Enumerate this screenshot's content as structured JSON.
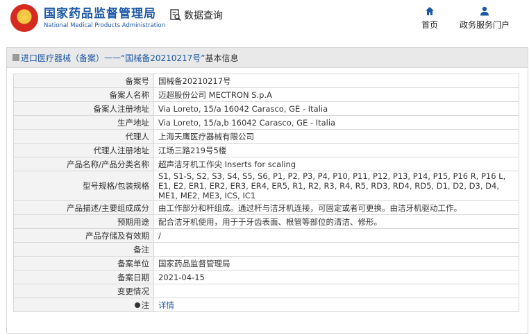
{
  "header": {
    "logo_cn": "国家药品监督管理局",
    "logo_en": "National Medical Products Administration",
    "search_label": "数据查询",
    "nav_home": "首页",
    "nav_portal": "政务服务门户"
  },
  "panel": {
    "title_prefix": "进口医疗器械（备案）",
    "title_sep": "——",
    "title_record": "“国械备20210217号”",
    "title_suffix": "基本信息"
  },
  "rows": [
    {
      "k": "备案号",
      "v": "国械备20210217号"
    },
    {
      "k": "备案人名称",
      "v": "迈超股份公司 MECTRON S.p.A"
    },
    {
      "k": "备案人注册地址",
      "v": "Via Loreto, 15/a 16042 Carasco, GE - Italia"
    },
    {
      "k": "生产地址",
      "v": "Via Loreto, 15/a,b 16042 Carasco, GE - Italia"
    },
    {
      "k": "代理人",
      "v": "上海天鹰医疗器械有限公司"
    },
    {
      "k": "代理人注册地址",
      "v": "江场三路219号5楼"
    },
    {
      "k": "产品名称/产品分类名称",
      "v": "超声洁牙机工作尖 Inserts for scaling"
    },
    {
      "k": "型号规格/包装规格",
      "v": "S1, S1-S, S2, S3, S4, S5, S6, P1, P2, P3, P4, P10, P11, P12, P13, P14, P15, P16 R, P16 L, E1, E2, ER1, ER2, ER3, ER4, ER5, R1, R2, R3, R4, R5, RD3, RD4, RD5, D1, D2, D3, D4, ME1, ME2, ME3, ICS, IC1"
    },
    {
      "k": "产品描述/主要组成成分",
      "v": "由工作部分和杆组成。通过杆与洁牙机连接，可固定或者可更换。由洁牙机驱动工作。"
    },
    {
      "k": "预期用途",
      "v": "配合洁牙机使用，用于于牙齿表面、根管等部位的清洁、修形。"
    },
    {
      "k": "产品存储及有效期",
      "v": "/"
    },
    {
      "k": "备注",
      "v": ""
    },
    {
      "k": "备案单位",
      "v": "国家药品监督管理局"
    },
    {
      "k": "备案日期",
      "v": "2021-04-15"
    },
    {
      "k": "变更情况",
      "v": ""
    },
    {
      "k": "注",
      "v": "详情"
    }
  ]
}
